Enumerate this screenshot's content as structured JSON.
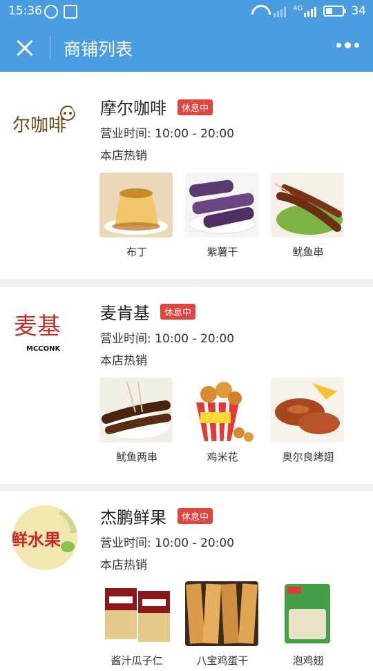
{
  "status": {
    "time": "15:36",
    "network": "4G",
    "battery": "34"
  },
  "nav": {
    "title": "商铺列表"
  },
  "shops": [
    {
      "name": "摩尔咖啡",
      "badge": "休息中",
      "hours": "营业时间: 10:00 - 20:00",
      "hot_label": "本店热销",
      "logo_text": "摩尔咖啡",
      "products": [
        {
          "name": "布丁"
        },
        {
          "name": "紫薯干"
        },
        {
          "name": "鱿鱼串"
        }
      ]
    },
    {
      "name": "麦肯基",
      "badge": "休息中",
      "hours": "营业时间: 10:00 - 20:00",
      "hot_label": "本店热销",
      "logo_text": "MCCONK",
      "products": [
        {
          "name": "鱿鱼两串"
        },
        {
          "name": "鸡米花"
        },
        {
          "name": "奥尔良烤翅"
        }
      ]
    },
    {
      "name": "杰鹏鲜果",
      "badge": "休息中",
      "hours": "营业时间: 10:00 - 20:00",
      "hot_label": "本店热销",
      "logo_text": "鲜水果",
      "products": [
        {
          "name": "酱汁瓜子仁"
        },
        {
          "name": "八宝鸡蛋干"
        },
        {
          "name": "泡鸡翅"
        }
      ]
    }
  ],
  "colors": {
    "primary": "#4a9de0",
    "badge": "#e0453f"
  }
}
